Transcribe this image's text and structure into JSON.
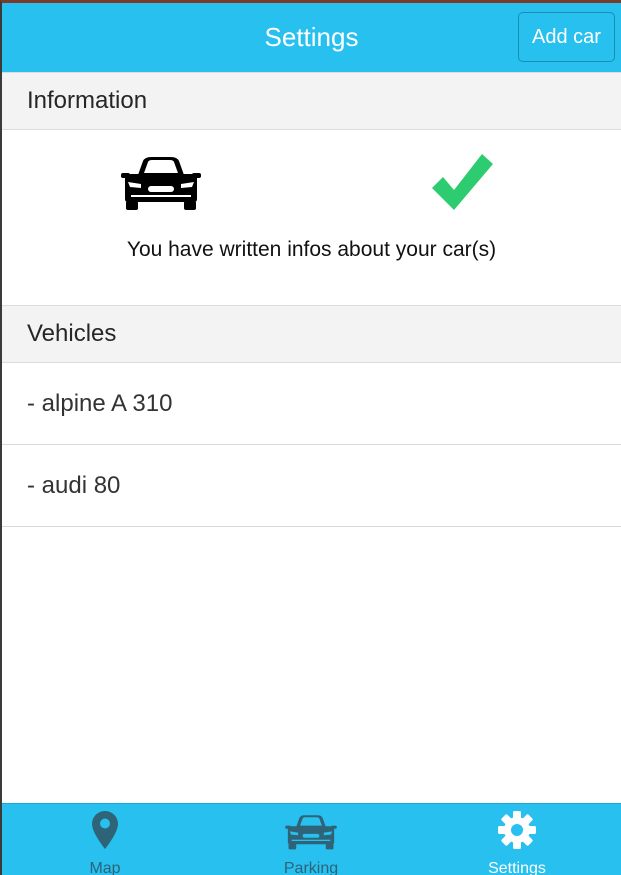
{
  "header": {
    "title": "Settings",
    "add_car_label": "Add car"
  },
  "information": {
    "section_title": "Information",
    "message": "You have written infos about your car(s)",
    "icons": [
      "car-icon",
      "checkmark-icon"
    ],
    "check_color": "#2ecc71"
  },
  "vehicles": {
    "section_title": "Vehicles",
    "items": [
      {
        "label": "- alpine A 310"
      },
      {
        "label": "- audi 80"
      }
    ]
  },
  "tabbar": {
    "tabs": [
      {
        "label": "Map",
        "icon": "map-pin-icon"
      },
      {
        "label": "Parking",
        "icon": "car-icon"
      },
      {
        "label": "Settings",
        "icon": "gear-icon",
        "active": true
      }
    ]
  },
  "colors": {
    "accent": "#27c0ef",
    "tab_inactive": "#2f6377",
    "tab_active": "#ffffff"
  }
}
